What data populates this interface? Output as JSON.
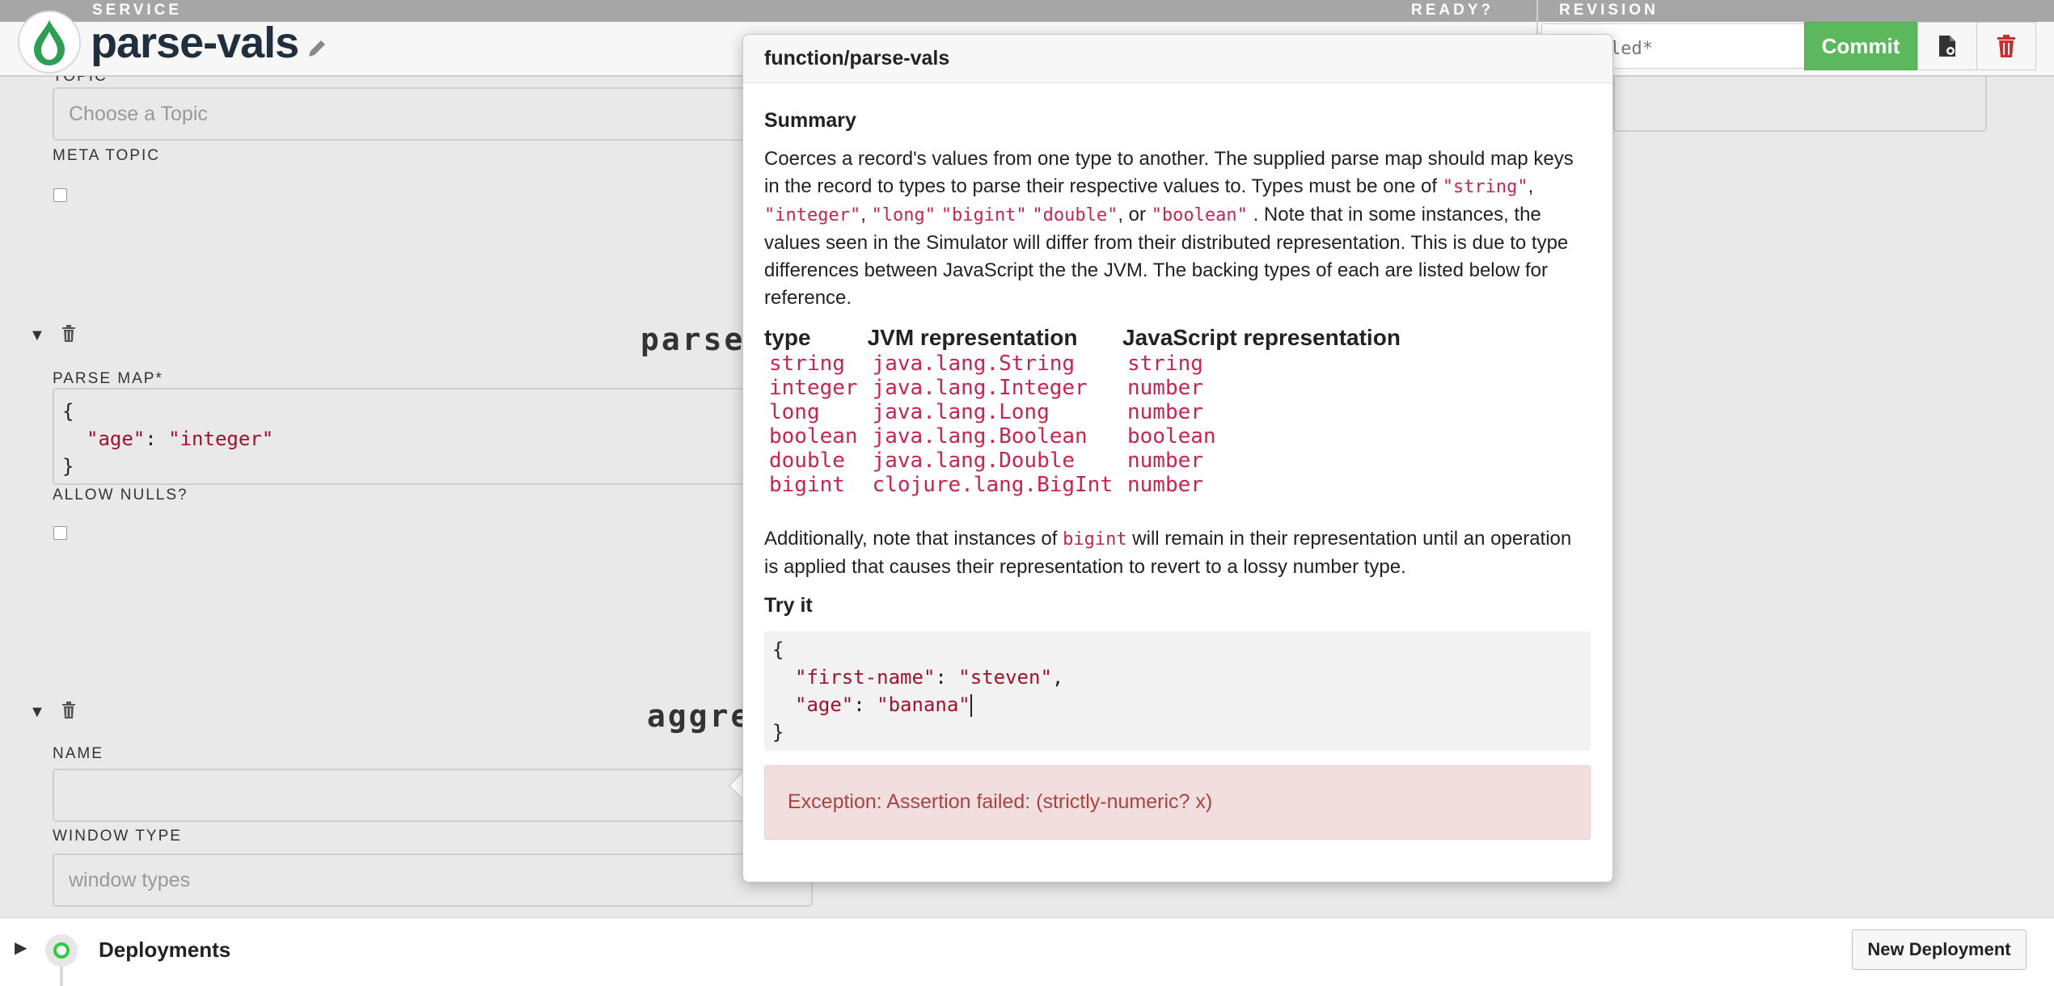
{
  "header": {
    "service_label": "SERVICE",
    "ready_label": "READY?",
    "revision_label": "REVISION",
    "title": "parse-vals",
    "revision_value": "led*",
    "commit_label": "Commit"
  },
  "form": {
    "topic_label": "TOPIC",
    "topic_placeholder": "Choose a Topic",
    "meta_topic_label": "META TOPIC",
    "section1_title": "parse-",
    "parse_map_label": "PARSE MAP*",
    "parse_map_lines": [
      "{",
      "\"age\"",
      ": ",
      "\"integer\"",
      "}"
    ],
    "allow_nulls_label": "ALLOW NULLS?",
    "section2_title": "aggreg",
    "name_label": "NAME",
    "window_type_label": "WINDOW TYPE",
    "window_type_placeholder": "window types"
  },
  "deployments": {
    "label": "Deployments",
    "new_button": "New Deployment"
  },
  "popover": {
    "title": "function/parse-vals",
    "summary_heading": "Summary",
    "summary_p1_a": "Coerces a record's values from one type to another. The supplied parse map should map keys in the record to types to parse their respective values to. Types must be one of",
    "types_inline": [
      "\"string\"",
      "\"integer\"",
      "\"long\"",
      "\"bigint\"",
      "\"double\"",
      "\"boolean\""
    ],
    "sep_comma": ",",
    "sep_or": ", or",
    "summary_p1_b": ". Note that in some instances, the values seen in the Simulator will differ from their distributed representation. This is due to type differences between JavaScript the the JVM. The backing types of each are listed below for reference.",
    "table_headers": [
      "type",
      "JVM representation",
      "JavaScript representation"
    ],
    "table_rows": [
      [
        "string",
        "java.lang.String",
        "string"
      ],
      [
        "integer",
        "java.lang.Integer",
        "number"
      ],
      [
        "long",
        "java.lang.Long",
        "number"
      ],
      [
        "boolean",
        "java.lang.Boolean",
        "boolean"
      ],
      [
        "double",
        "java.lang.Double",
        "number"
      ],
      [
        "bigint",
        "clojure.lang.BigInt",
        "number"
      ]
    ],
    "additional_a": "Additionally, note that instances of",
    "additional_code": "bigint",
    "additional_b": "will remain in their representation until an operation is applied that causes their representation to revert to a lossy number type.",
    "try_heading": "Try it",
    "editor": {
      "open": "{",
      "key1": "\"first-name\"",
      "val1": "\"steven\"",
      "comma": ",",
      "key2": "\"age\"",
      "val2": "\"banana\"",
      "colon": ": ",
      "close": "}"
    },
    "exception": "Exception: Assertion failed: (strictly-numeric? x)"
  },
  "colors": {
    "commit_green": "#5cb85c",
    "exception_bg": "#f2dede",
    "exception_text": "#a94442",
    "code_red": "#c7254e"
  }
}
